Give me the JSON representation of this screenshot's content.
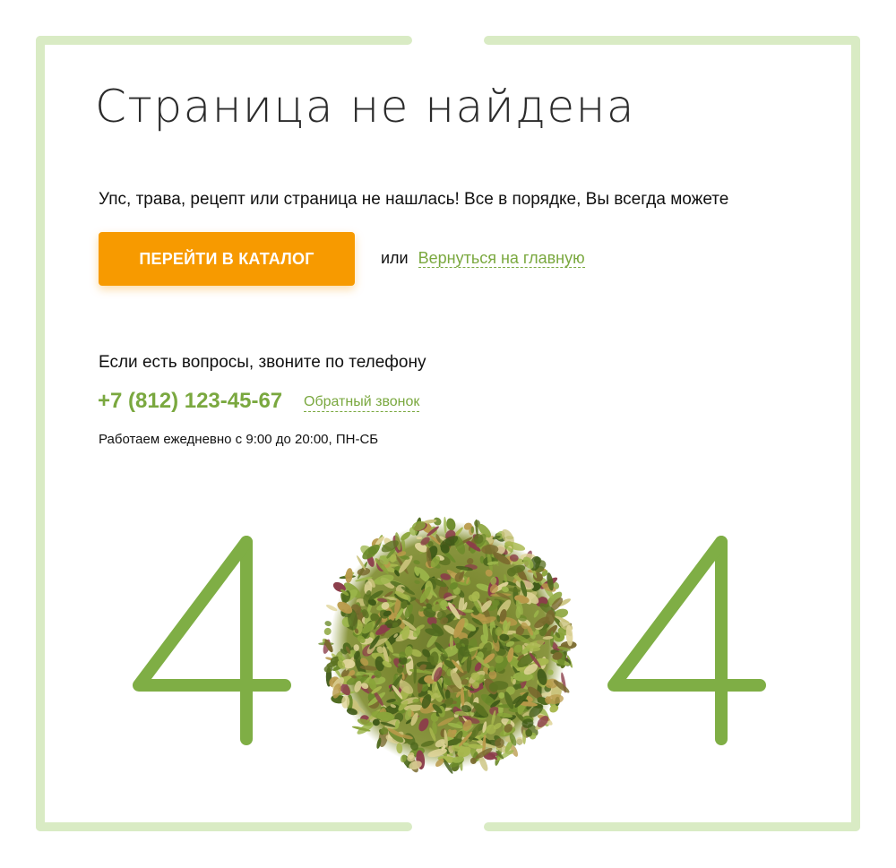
{
  "page": {
    "title": "Страница не найдена",
    "intro": "Упс, трава, рецепт или страница не нашлась! Все в порядке, Вы всегда можете",
    "catalog_button_label": "ПЕРЕЙТИ В КАТАЛОГ",
    "or_text": "или",
    "home_link_label": "Вернуться на главную",
    "questions_text": "Если есть вопросы, звоните по телефону",
    "phone": "+7 (812) 123-45-67",
    "callback_label": "Обратный звонок",
    "hours": "Работаем ежедневно с 9:00 до 20:00, ПН-СБ"
  },
  "graphic": {
    "digits": [
      "4",
      "4"
    ],
    "center_image": "herbal-tea-pile",
    "digit_color": "#7fae45"
  },
  "colors": {
    "accent_green": "#7aa83f",
    "button_orange": "#f79a00",
    "frame_green": "#d9ebc4",
    "text": "#111111"
  }
}
